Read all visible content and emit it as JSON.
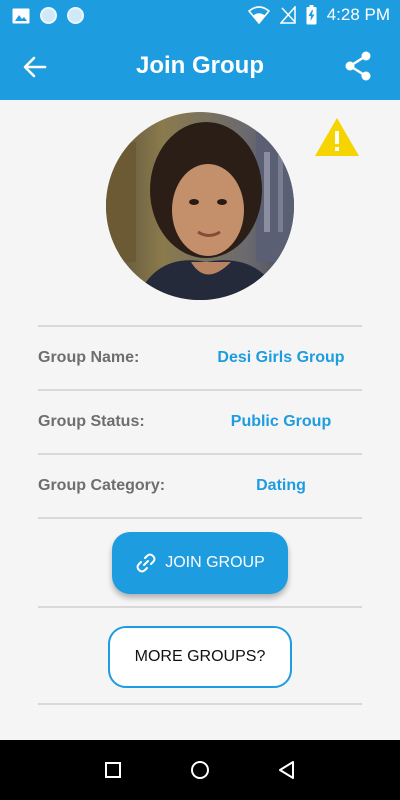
{
  "status_bar": {
    "time": "4:28 PM",
    "icons": [
      "image-icon",
      "notification-dot-icon",
      "notification-dot-icon",
      "wifi-icon",
      "signal-off-icon",
      "battery-charging-icon"
    ]
  },
  "app_bar": {
    "title": "Join Group",
    "back_icon": "arrow-back-icon",
    "share_icon": "share-icon"
  },
  "group": {
    "avatar_icon": "group-avatar-photo",
    "warning_icon": "warning-icon",
    "fields": [
      {
        "label": "Group Name:",
        "value": "Desi Girls Group"
      },
      {
        "label": "Group Status:",
        "value": "Public Group"
      },
      {
        "label": "Group Category:",
        "value": "Dating"
      }
    ]
  },
  "actions": {
    "join_label": "JOIN GROUP",
    "join_icon": "link-icon",
    "more_label": "MORE GROUPS?"
  },
  "colors": {
    "primary": "#1e9ce0",
    "label_gray": "#6e6e6e",
    "warning": "#f5d400"
  },
  "nav_bar": {
    "icons": [
      "recents-square-icon",
      "home-circle-icon",
      "back-triangle-icon"
    ]
  }
}
